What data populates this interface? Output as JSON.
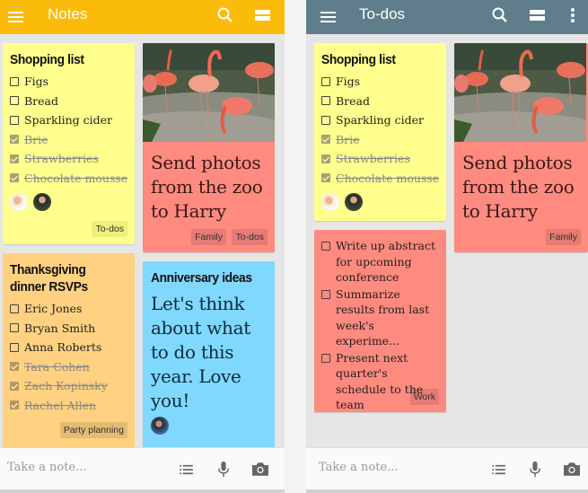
{
  "left_phone": {
    "appbar": {
      "title": "Notes",
      "color": "#fbbb0a"
    },
    "notes": {
      "shopping": {
        "title": "Shopping list",
        "items": [
          {
            "text": "Figs",
            "checked": false
          },
          {
            "text": "Bread",
            "checked": false
          },
          {
            "text": "Sparkling cider",
            "checked": false
          },
          {
            "text": "Brie",
            "checked": true
          },
          {
            "text": "Strawberries",
            "checked": true
          },
          {
            "text": "Chocolate mousse",
            "checked": true
          }
        ],
        "labels": [
          "To-dos"
        ]
      },
      "zoo": {
        "text": "Send photos from the zoo to Harry",
        "labels": [
          "Family",
          "To-dos"
        ]
      },
      "thanksgiving": {
        "title": "Thanksgiving dinner RSVPs",
        "items": [
          {
            "text": "Eric Jones",
            "checked": false
          },
          {
            "text": "Bryan Smith",
            "checked": false
          },
          {
            "text": "Anna Roberts",
            "checked": false
          },
          {
            "text": "Tara Cohen",
            "checked": true
          },
          {
            "text": "Zach Kopinsky",
            "checked": true
          },
          {
            "text": "Rachel Allen",
            "checked": true
          }
        ],
        "labels": [
          "Party planning"
        ]
      },
      "anniversary": {
        "title": "Anniversary ideas",
        "text": "Let's think about what to do this year. Love you!"
      }
    },
    "bottombar": {
      "placeholder": "Take a note..."
    }
  },
  "right_phone": {
    "appbar": {
      "title": "To-dos",
      "color": "#607d8b"
    },
    "notes": {
      "shopping": {
        "title": "Shopping list",
        "items": [
          {
            "text": "Figs",
            "checked": false
          },
          {
            "text": "Bread",
            "checked": false
          },
          {
            "text": "Sparkling cider",
            "checked": false
          },
          {
            "text": "Brie",
            "checked": true
          },
          {
            "text": "Strawberries",
            "checked": true
          },
          {
            "text": "Chocolate mousse",
            "checked": true
          }
        ]
      },
      "zoo": {
        "text": "Send photos from the zoo to Harry",
        "labels": [
          "Family"
        ]
      },
      "work": {
        "items": [
          {
            "text": "Write up abstract for upcoming conference",
            "checked": false
          },
          {
            "text": "Summarize results from last week's experime...",
            "checked": false
          },
          {
            "text": "Present next quarter's schedule to the team",
            "checked": false
          }
        ],
        "labels": [
          "Work"
        ]
      }
    },
    "bottombar": {
      "placeholder": "Take a note..."
    }
  },
  "icons": {
    "menu": "menu-icon",
    "search": "search-icon",
    "view": "view-toggle-icon",
    "more": "more-vert-icon",
    "list": "list-icon",
    "mic": "mic-icon",
    "camera": "camera-icon"
  },
  "colors": {
    "yellow": "#ffff8d",
    "orange": "#ffd180",
    "red": "#ff8a80",
    "blue": "#80d8ff"
  }
}
